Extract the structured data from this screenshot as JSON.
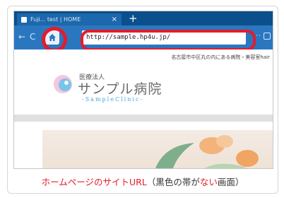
{
  "browser": {
    "tab_title": "Fuji... test | HOME",
    "tab_close": "×",
    "new_tab": "+",
    "url": "http://sample.hp4u.jp/",
    "menu": "···"
  },
  "site": {
    "tagline": "名古屋市中区丸の内にある病院・美容室hair",
    "logo_small": "医療法人",
    "logo_name": "サンプル病院",
    "logo_en": "-SampleClinic-"
  },
  "caption": {
    "part1": "ホームページのサイトURL",
    "part2": "（黒色の帯が",
    "part3": "ない",
    "part4": "画面）"
  },
  "colors": {
    "highlight": "#e51b2b",
    "toolbar": "#2a77c0",
    "tabbar": "#0b4f8c"
  },
  "icons": [
    "back-arrow-icon",
    "forward-arrow-icon",
    "home-icon",
    "menu-dots-icon",
    "pocket-icon",
    "tab-favicon-icon"
  ]
}
